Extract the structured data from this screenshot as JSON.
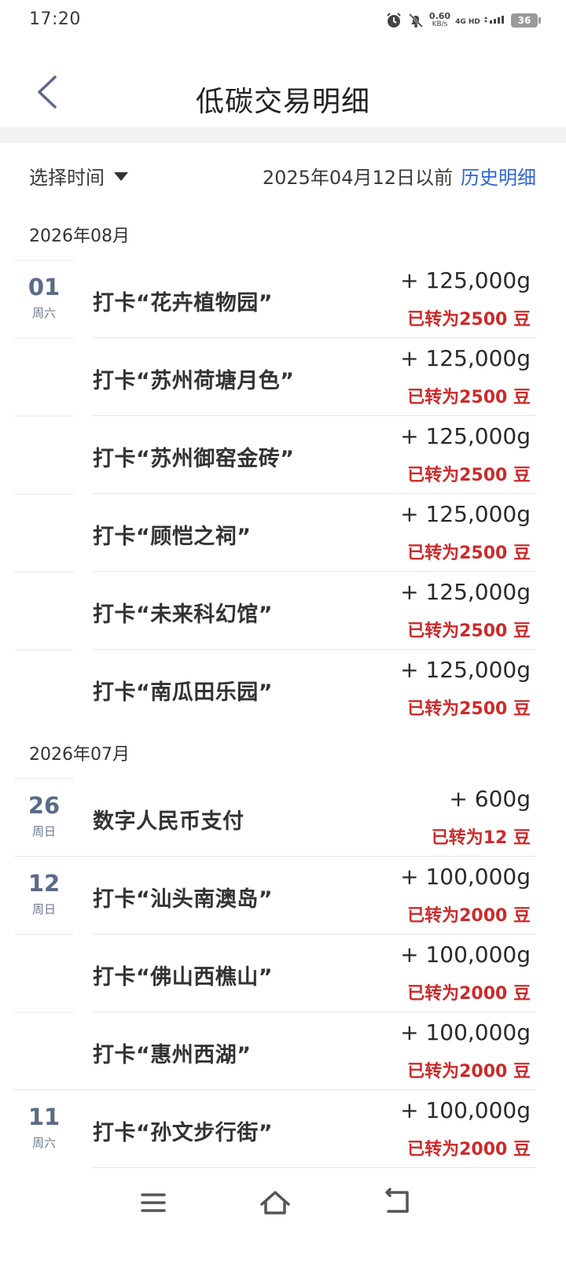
{
  "status_bar": {
    "time": "17:20",
    "speed_value": "0.60",
    "speed_unit": "KB/s",
    "network_top": "4G HD",
    "battery": "36"
  },
  "header": {
    "title": "低碳交易明细"
  },
  "filter": {
    "select_label": "选择时间",
    "date_note": "2025年04月12日以前",
    "history_link": "历史明细"
  },
  "months": [
    {
      "label": "2026年08月",
      "rows": [
        {
          "day": "01",
          "weekday": "周六",
          "title": "打卡“花卉植物园”",
          "amount": "+ 125,000g",
          "converted": "已转为2500 豆"
        },
        {
          "day": "",
          "weekday": "",
          "title": "打卡“苏州荷塘月色”",
          "amount": "+ 125,000g",
          "converted": "已转为2500 豆"
        },
        {
          "day": "",
          "weekday": "",
          "title": "打卡“苏州御窑金砖”",
          "amount": "+ 125,000g",
          "converted": "已转为2500 豆"
        },
        {
          "day": "",
          "weekday": "",
          "title": "打卡“顾恺之祠”",
          "amount": "+ 125,000g",
          "converted": "已转为2500 豆"
        },
        {
          "day": "",
          "weekday": "",
          "title": "打卡“未来科幻馆”",
          "amount": "+ 125,000g",
          "converted": "已转为2500 豆"
        },
        {
          "day": "",
          "weekday": "",
          "title": "打卡“南瓜田乐园”",
          "amount": "+ 125,000g",
          "converted": "已转为2500 豆"
        }
      ]
    },
    {
      "label": "2026年07月",
      "rows": [
        {
          "day": "26",
          "weekday": "周日",
          "title": "数字人民币支付",
          "amount": "+ 600g",
          "converted": "已转为12 豆"
        },
        {
          "day": "12",
          "weekday": "周日",
          "title": "打卡“汕头南澳岛”",
          "amount": "+ 100,000g",
          "converted": "已转为2000 豆"
        },
        {
          "day": "",
          "weekday": "",
          "title": "打卡“佛山西樵山”",
          "amount": "+ 100,000g",
          "converted": "已转为2000 豆"
        },
        {
          "day": "",
          "weekday": "",
          "title": "打卡“惠州西湖”",
          "amount": "+ 100,000g",
          "converted": "已转为2000 豆"
        },
        {
          "day": "11",
          "weekday": "周六",
          "title": "打卡“孙文步行街”",
          "amount": "+ 100,000g",
          "converted": "已转为2000 豆"
        }
      ]
    }
  ],
  "colors": {
    "accent_link": "#2f65d6",
    "converted_red": "#cc2b2b",
    "date_blue_gray": "#5b6b87"
  },
  "icons": {
    "back": "chevron-left-icon",
    "dropdown": "caret-down-icon",
    "menu": "menu-icon",
    "home": "home-icon",
    "return": "back-arrow-icon"
  }
}
